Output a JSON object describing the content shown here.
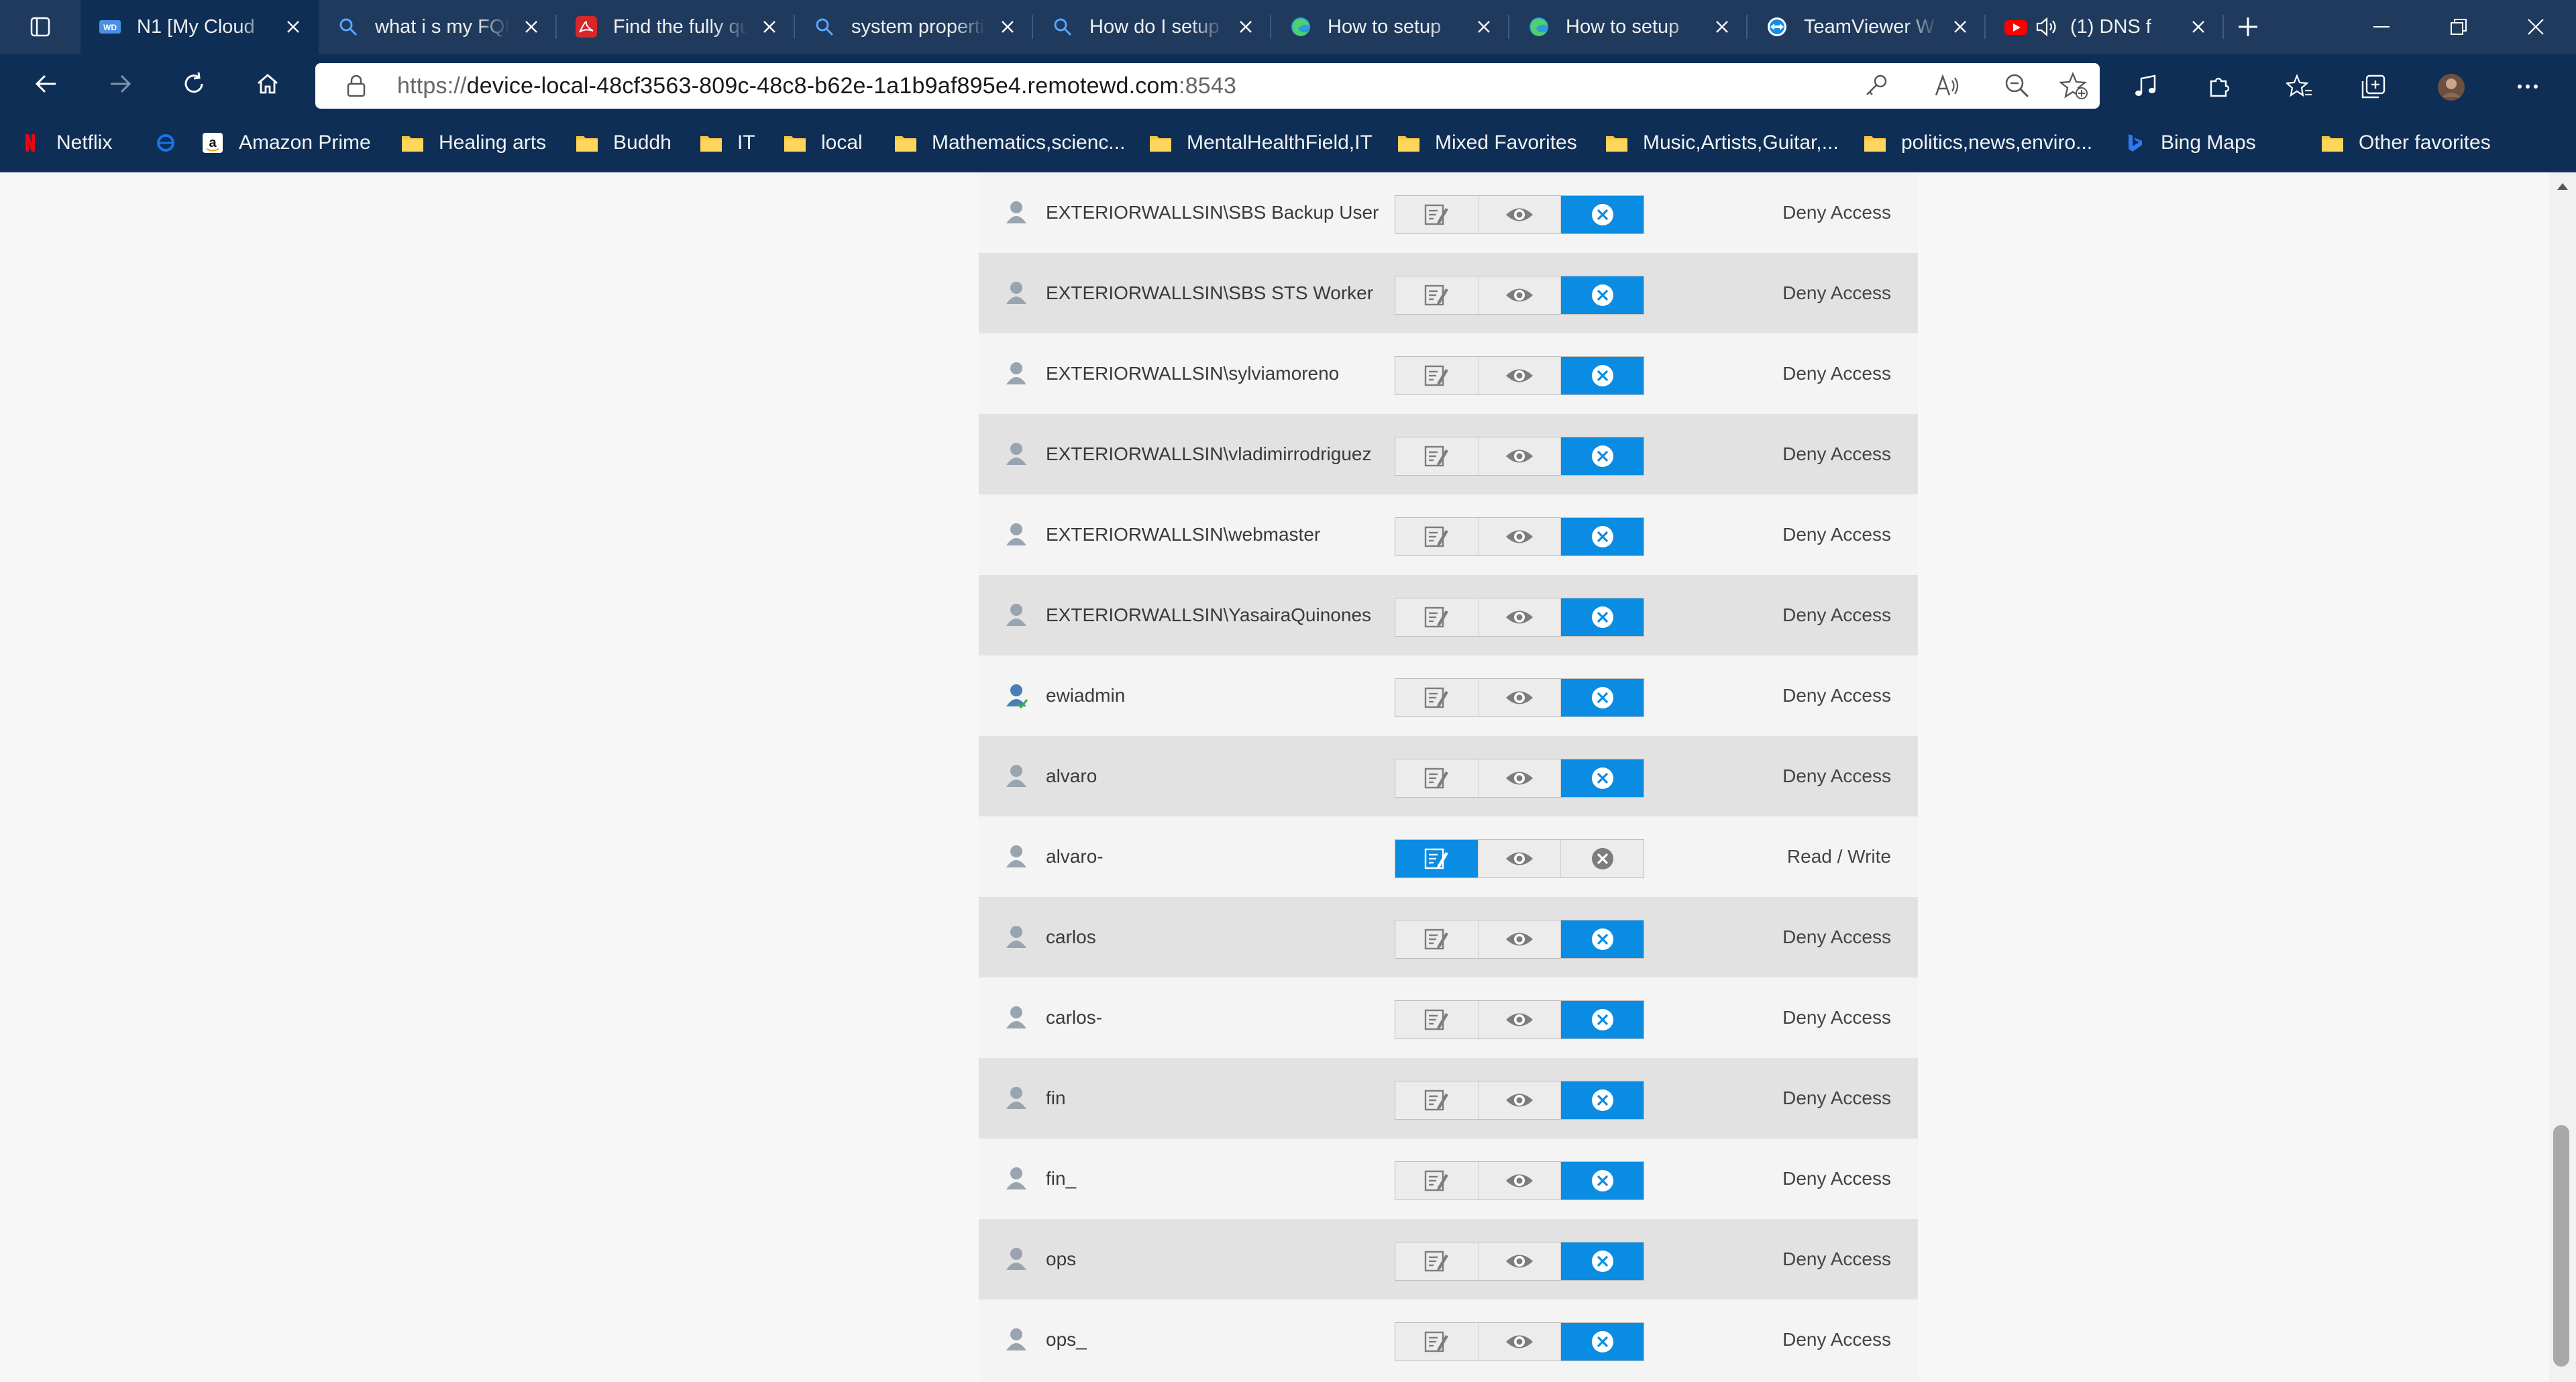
{
  "tabs": [
    {
      "title": "N1 [My Cloud",
      "icon": "wd-logo-icon",
      "active": true
    },
    {
      "title": "what i s my FQDN",
      "icon": "search-icon"
    },
    {
      "title": "Find the fully qualified",
      "icon": "acrobat-icon"
    },
    {
      "title": "system properties",
      "icon": "search-icon"
    },
    {
      "title": "How do I setup",
      "icon": "search-icon"
    },
    {
      "title": "How to setup",
      "icon": "edge-icon"
    },
    {
      "title": "How to setup",
      "icon": "edge-icon"
    },
    {
      "title": "TeamViewer W",
      "icon": "teamviewer-icon"
    },
    {
      "title": "(1) DNS f",
      "icon": "youtube-icon",
      "audio": true
    }
  ],
  "address_bar": {
    "scheme": "https://",
    "host": "device-local-48cf3563-809c-48c8-b62e-1a1b9af895e4.remotewd.com",
    "port": ":8543"
  },
  "bookmarks": [
    {
      "label": "Netflix",
      "icon": "netflix-icon"
    },
    {
      "label": "",
      "icon": "ie-icon"
    },
    {
      "label": "Amazon Prime",
      "icon": "amazon-icon"
    },
    {
      "label": "Healing arts",
      "icon": "folder-icon"
    },
    {
      "label": "Buddh",
      "icon": "folder-icon"
    },
    {
      "label": "IT",
      "icon": "folder-icon"
    },
    {
      "label": "local",
      "icon": "folder-icon"
    },
    {
      "label": "Mathematics,scienc...",
      "icon": "folder-icon"
    },
    {
      "label": "MentalHealthField,IT",
      "icon": "folder-icon"
    },
    {
      "label": "Mixed Favorites",
      "icon": "folder-icon"
    },
    {
      "label": "Music,Artists,Guitar,...",
      "icon": "folder-icon"
    },
    {
      "label": "politics,news,enviro...",
      "icon": "folder-icon"
    },
    {
      "label": "Bing Maps",
      "icon": "bing-icon"
    }
  ],
  "other_favorites": "Other favorites",
  "permissions": [
    {
      "user": "EXTERIORWALLSIN\\SBS Backup User",
      "access": "Deny Access",
      "mode": "deny"
    },
    {
      "user": "EXTERIORWALLSIN\\SBS STS Worker",
      "access": "Deny Access",
      "mode": "deny"
    },
    {
      "user": "EXTERIORWALLSIN\\sylviamoreno",
      "access": "Deny Access",
      "mode": "deny"
    },
    {
      "user": "EXTERIORWALLSIN\\vladimirrodriguez",
      "access": "Deny Access",
      "mode": "deny"
    },
    {
      "user": "EXTERIORWALLSIN\\webmaster",
      "access": "Deny Access",
      "mode": "deny"
    },
    {
      "user": "EXTERIORWALLSIN\\YasairaQuinones",
      "access": "Deny Access",
      "mode": "deny"
    },
    {
      "user": "ewiadmin",
      "access": "Deny Access",
      "mode": "deny",
      "admin": true
    },
    {
      "user": "alvaro",
      "access": "Deny Access",
      "mode": "deny"
    },
    {
      "user": "alvaro-",
      "access": "Read / Write",
      "mode": "rw"
    },
    {
      "user": "carlos",
      "access": "Deny Access",
      "mode": "deny"
    },
    {
      "user": "carlos-",
      "access": "Deny Access",
      "mode": "deny"
    },
    {
      "user": "fin",
      "access": "Deny Access",
      "mode": "deny"
    },
    {
      "user": "fin_",
      "access": "Deny Access",
      "mode": "deny"
    },
    {
      "user": "ops",
      "access": "Deny Access",
      "mode": "deny"
    },
    {
      "user": "ops_",
      "access": "Deny Access",
      "mode": "deny"
    }
  ],
  "colors": {
    "accent": "#0a8ce2",
    "titlebar": "#1f3a5d",
    "toolbar": "#0f2e55"
  }
}
